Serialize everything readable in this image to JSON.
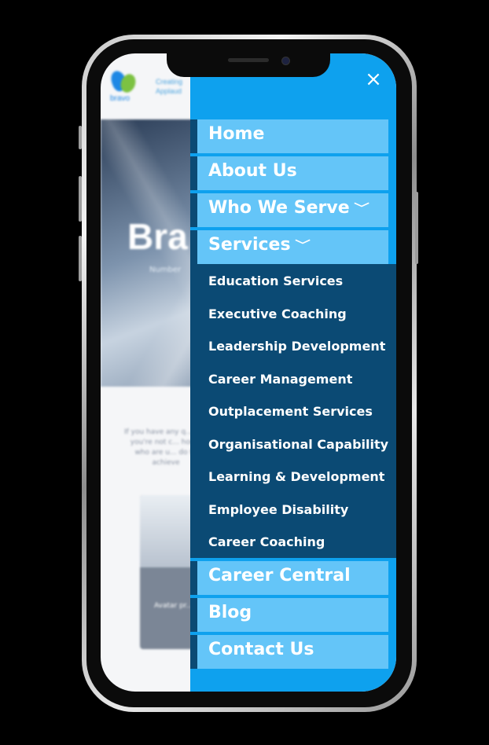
{
  "site": {
    "logo_text": "bravo",
    "tagline": [
      "Creating",
      "Applaud"
    ],
    "hero_title": "Bra",
    "hero_subtitle": "Number",
    "paragraph": "If you have any q... you you're not c... home who are u... do to achieve",
    "card_text": "Avatar pr..."
  },
  "menu": {
    "close_label": "×",
    "items": [
      {
        "label": "Home",
        "has_dropdown": false
      },
      {
        "label": "About Us",
        "has_dropdown": false
      },
      {
        "label": "Who We Serve",
        "has_dropdown": true
      },
      {
        "label": "Services",
        "has_dropdown": true
      }
    ],
    "services_submenu": [
      "Education Services",
      "Executive Coaching",
      "Leadership Development",
      "Career Management",
      "Outplacement Services",
      "Organisational Capability",
      "Learning & Development",
      "Employee Disability",
      "Career Coaching"
    ],
    "items_after": [
      {
        "label": "Career Central"
      },
      {
        "label": "Blog"
      },
      {
        "label": "Contact Us"
      }
    ],
    "chevron_glyph": "﹀"
  },
  "colors": {
    "drawer_bg": "#0ea1ee",
    "item_bg": "#64c5f8",
    "item_accent": "#0b4a74",
    "submenu_bg": "#0b4a74"
  }
}
